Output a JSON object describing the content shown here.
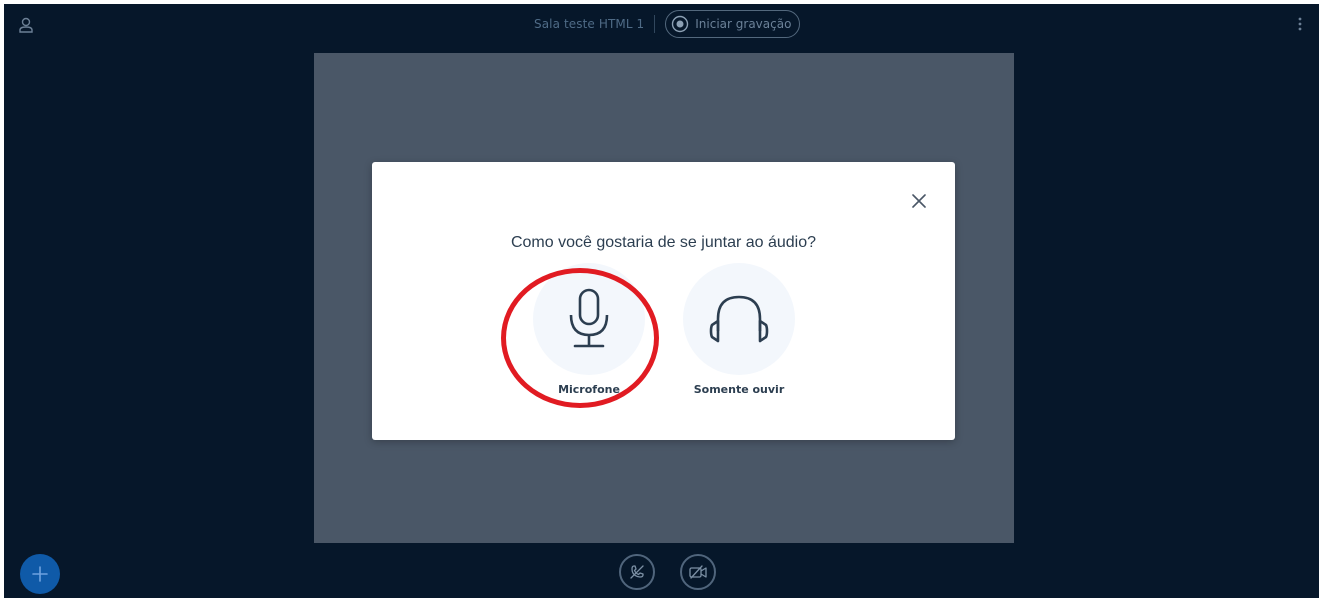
{
  "header": {
    "room_title": "Sala teste HTML 1",
    "record_label": "Iniciar gravação"
  },
  "modal": {
    "title": "Como você gostaria de se juntar ao áudio?",
    "options": [
      {
        "label": "Microfone",
        "icon": "microphone-icon"
      },
      {
        "label": "Somente ouvir",
        "icon": "headphones-icon"
      }
    ]
  },
  "colors": {
    "background": "#06172a",
    "presentation": "#4a5767",
    "modal": "#ffffff",
    "annotation": "#e11b22",
    "fab": "#0f5aa8"
  }
}
